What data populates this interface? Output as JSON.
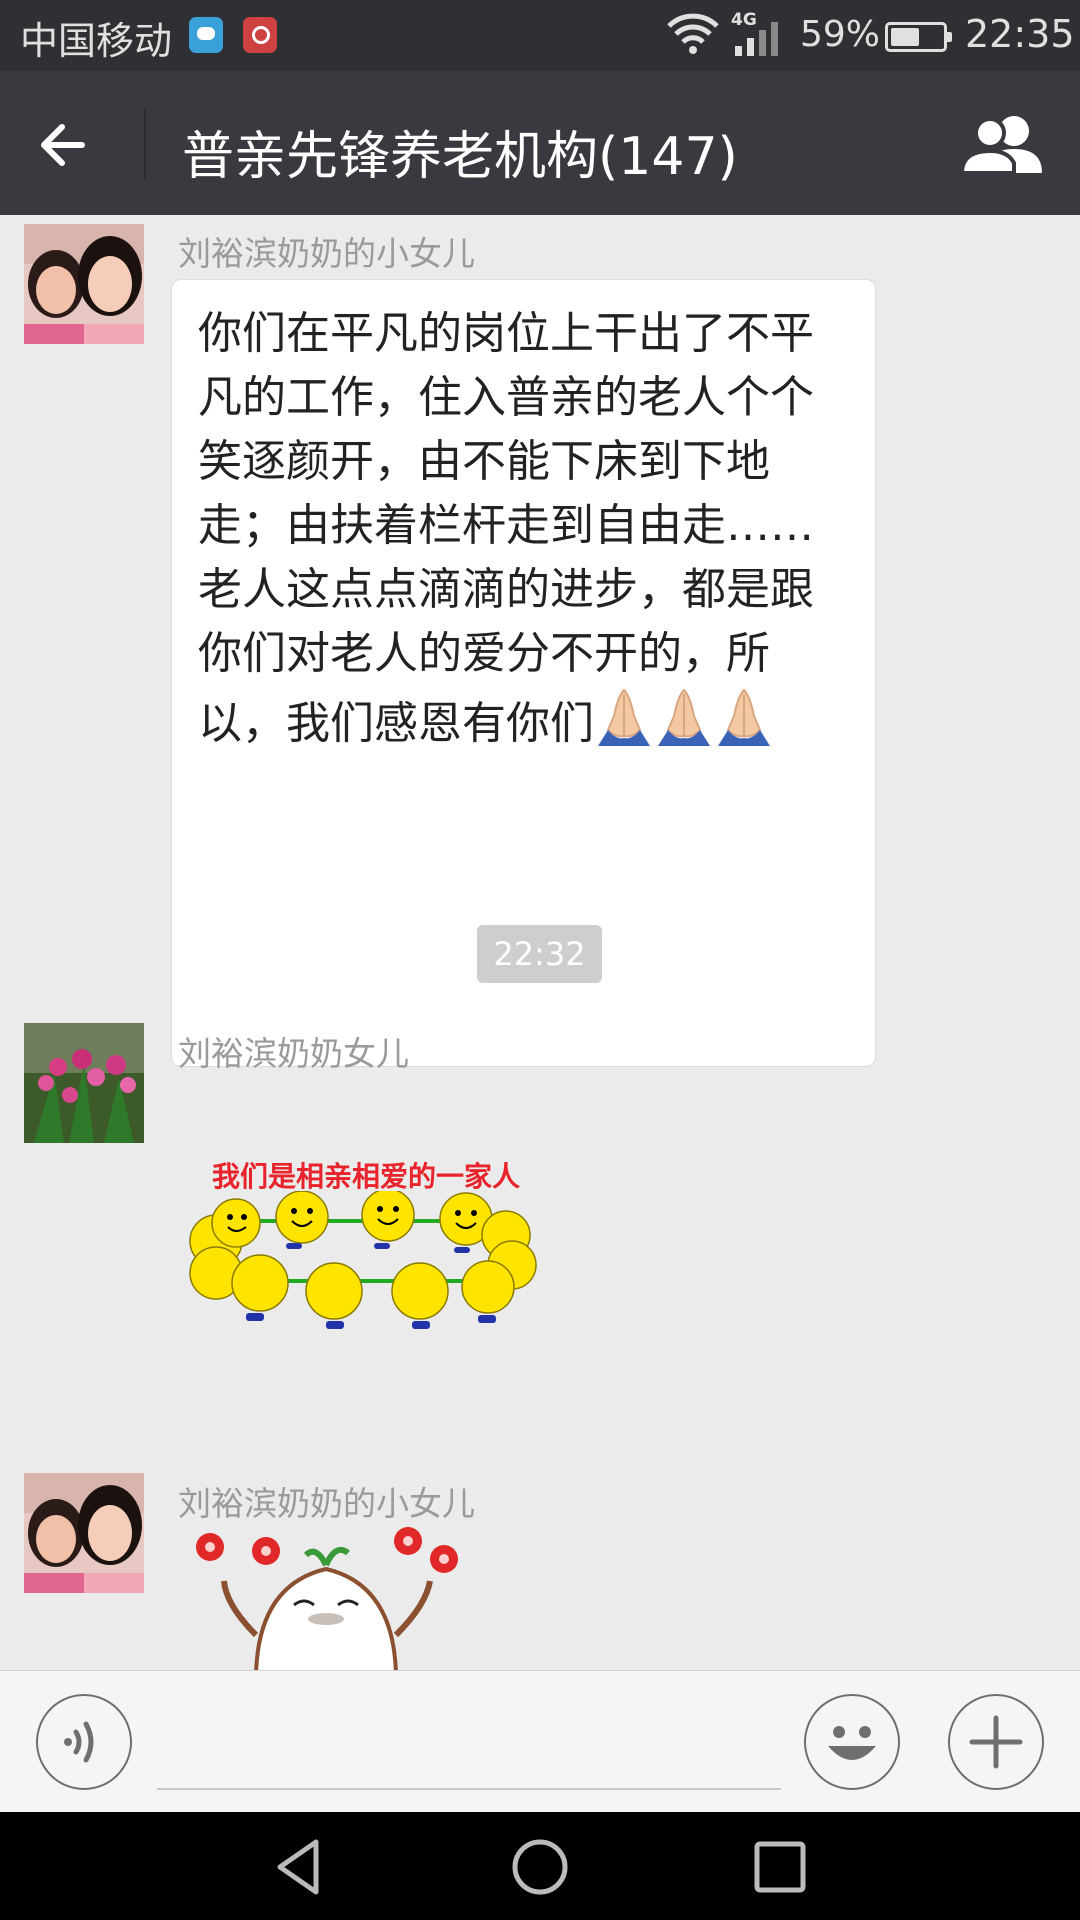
{
  "status_bar": {
    "carrier": "中国移动",
    "network_type": "4G",
    "battery_percent": "59%",
    "time": "22:35",
    "icons": [
      "message-app-icon",
      "notification-app-icon",
      "wifi-icon",
      "signal-icon",
      "battery-icon"
    ]
  },
  "header": {
    "title": "普亲先锋养老机构(147)",
    "back_icon": "arrow-left-icon",
    "members_icon": "group-members-icon"
  },
  "messages": [
    {
      "sender": "刘裕滨奶奶的小女儿",
      "type": "text",
      "text": "你们在平凡的岗位上干出了不平凡的工作，住入普亲的老人个个笑逐颜开，由不能下床到下地走；由扶着栏杆走到自由走……老人这点点滴滴的进步，都是跟你们对老人的爱分不开的，所以，我们感恩有你们",
      "emoji": [
        "folded-hands",
        "folded-hands",
        "folded-hands"
      ]
    },
    {
      "type": "timestamp",
      "text": "22:32"
    },
    {
      "sender": "刘裕滨奶奶女儿",
      "type": "sticker",
      "sticker_text": "我们是相亲相爱的一家人"
    },
    {
      "sender": "刘裕滨奶奶的小女儿",
      "type": "sticker",
      "sticker_text": ""
    }
  ],
  "input_bar": {
    "voice_icon": "voice-icon",
    "emoji_icon": "smiley-icon",
    "more_icon": "plus-icon",
    "placeholder": ""
  },
  "nav_bar": {
    "icons": [
      "nav-back-icon",
      "nav-home-icon",
      "nav-recents-icon"
    ]
  },
  "colors": {
    "status_bar_bg": "#2f3033",
    "title_bar_bg": "#393a3f",
    "chat_bg": "#ebebeb",
    "sticker_text": "#e8232b",
    "smiley_yellow": "#ffe400"
  }
}
